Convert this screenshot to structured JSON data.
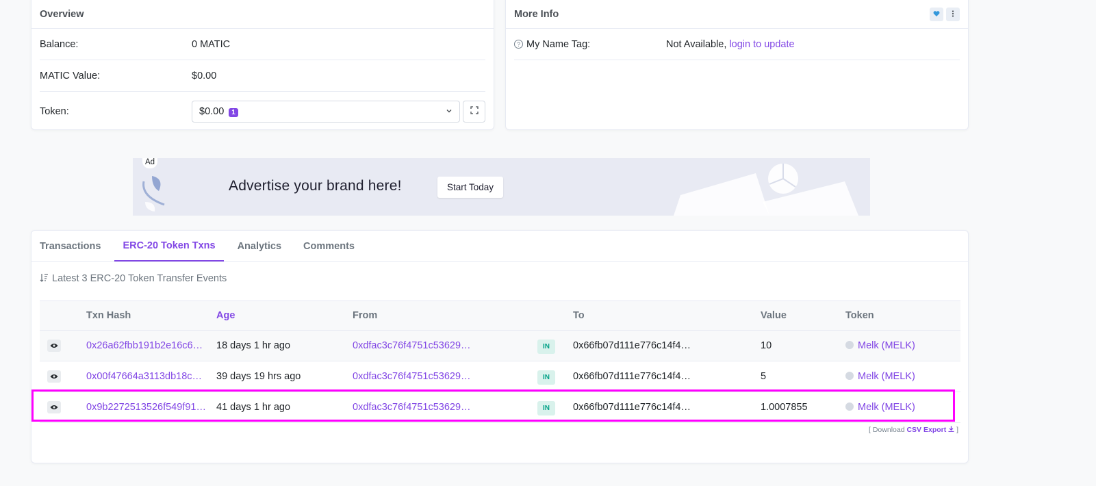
{
  "overview": {
    "title": "Overview",
    "balance_label": "Balance:",
    "balance_value": "0 MATIC",
    "value_label": "MATIC Value:",
    "value_value": "$0.00",
    "token_label": "Token:",
    "token_value": "$0.00",
    "token_count": "1"
  },
  "more_info": {
    "title": "More Info",
    "name_tag_label": "My Name Tag:",
    "name_tag_value": "Not Available,",
    "login_link": "login to update"
  },
  "ad": {
    "tag": "Ad",
    "headline": "Advertise your brand here!",
    "button": "Start Today"
  },
  "tabs": [
    "Transactions",
    "ERC-20 Token Txns",
    "Analytics",
    "Comments"
  ],
  "summary": "Latest 3 ERC-20 Token Transfer Events",
  "table": {
    "headers": [
      "Txn Hash",
      "Age",
      "From",
      "",
      "To",
      "Value",
      "Token"
    ],
    "rows": [
      {
        "hash": "0x26a62fbb191b2e16c6…",
        "age": "18 days 1 hr ago",
        "from": "0xdfac3c76f4751c53629…",
        "dir": "IN",
        "to": "0x66fb07d111e776c14f4…",
        "value": "10",
        "token": "Melk (MELK)"
      },
      {
        "hash": "0x00f47664a3113db18c…",
        "age": "39 days 19 hrs ago",
        "from": "0xdfac3c76f4751c53629…",
        "dir": "IN",
        "to": "0x66fb07d111e776c14f4…",
        "value": "5",
        "token": "Melk (MELK)"
      },
      {
        "hash": "0x9b2272513526f549f91…",
        "age": "41 days 1 hr ago",
        "from": "0xdfac3c76f4751c53629…",
        "dir": "IN",
        "to": "0x66fb07d111e776c14f4…",
        "value": "1.0007855",
        "token": "Melk (MELK)"
      }
    ]
  },
  "csv": {
    "prefix": "[ Download",
    "link": "CSV Export",
    "suffix": "]"
  },
  "colors": {
    "accent": "#8247e5",
    "highlight": "#ff00ff",
    "in_badge": "#00a186"
  }
}
